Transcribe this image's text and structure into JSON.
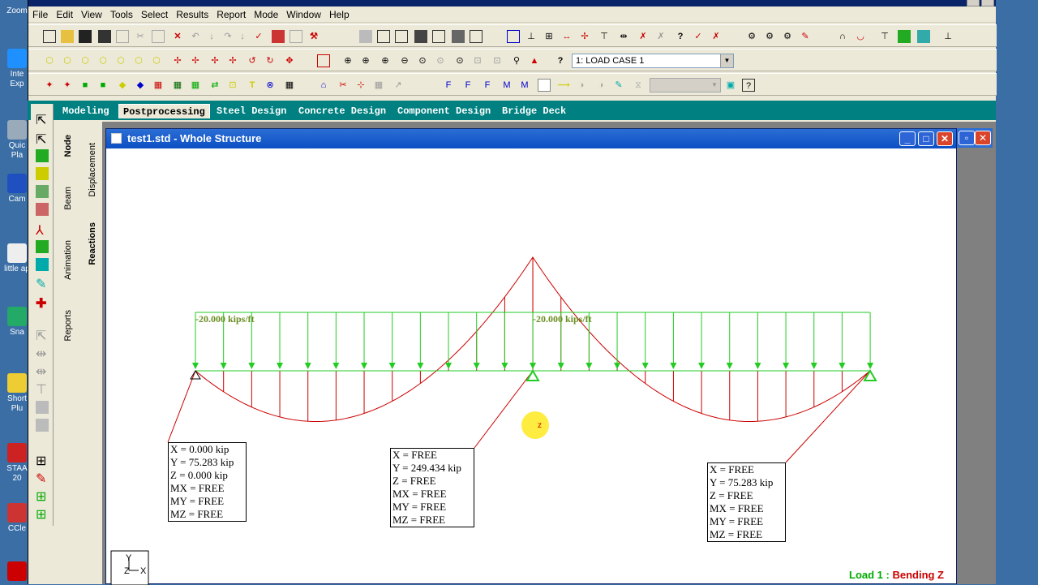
{
  "menu": [
    "File",
    "Edit",
    "View",
    "Tools",
    "Select",
    "Results",
    "Report",
    "Mode",
    "Window",
    "Help"
  ],
  "load_case_select": {
    "value": "1: LOAD CASE 1"
  },
  "page_tabs": [
    "Modeling",
    "Postprocessing",
    "Steel Design",
    "Concrete Design",
    "Component Design",
    "Bridge Deck"
  ],
  "active_tab": "Postprocessing",
  "side_tabs": {
    "node": "Node",
    "beam": "Beam",
    "animation": "Animation",
    "reports": "Reports",
    "displacement": "Displacement",
    "reactions": "Reactions"
  },
  "window": {
    "title": "test1.std - Whole Structure"
  },
  "load_labels": [
    "-20.000 kips/ft",
    "-20.000 kips/ft"
  ],
  "reactions": [
    {
      "lines": [
        "X = 0.000 kip",
        "Y = 75.283 kip",
        "Z = 0.000 kip",
        "MX = FREE",
        "MY = FREE",
        "MZ = FREE"
      ]
    },
    {
      "lines": [
        "X = FREE",
        "Y = 249.434 kip",
        "Z = FREE",
        "MX = FREE",
        "MY = FREE",
        "MZ = FREE"
      ]
    },
    {
      "lines": [
        "X = FREE",
        "Y = 75.283 kip",
        "Z = FREE",
        "MX = FREE",
        "MY = FREE",
        "MZ = FREE"
      ]
    }
  ],
  "axes": {
    "y": "Y",
    "z": "Z",
    "x": "X"
  },
  "cursor_label": "z",
  "status_label": {
    "load": "Load 1 : ",
    "diagram": "Bending Z"
  },
  "desktop_icons": [
    {
      "label": "Zoom"
    },
    {
      "label": "Inte Exp"
    },
    {
      "label": "Quic Pla"
    },
    {
      "label": "Cam"
    },
    {
      "label": "little ap"
    },
    {
      "label": "Sna"
    },
    {
      "label": "Short Plu"
    },
    {
      "label": "STAA 20"
    },
    {
      "label": "CCle"
    }
  ],
  "colors": {
    "load": "#22cc22",
    "moment": "#cc0000",
    "load_text": "#6b8e23",
    "teal": "#008080"
  }
}
